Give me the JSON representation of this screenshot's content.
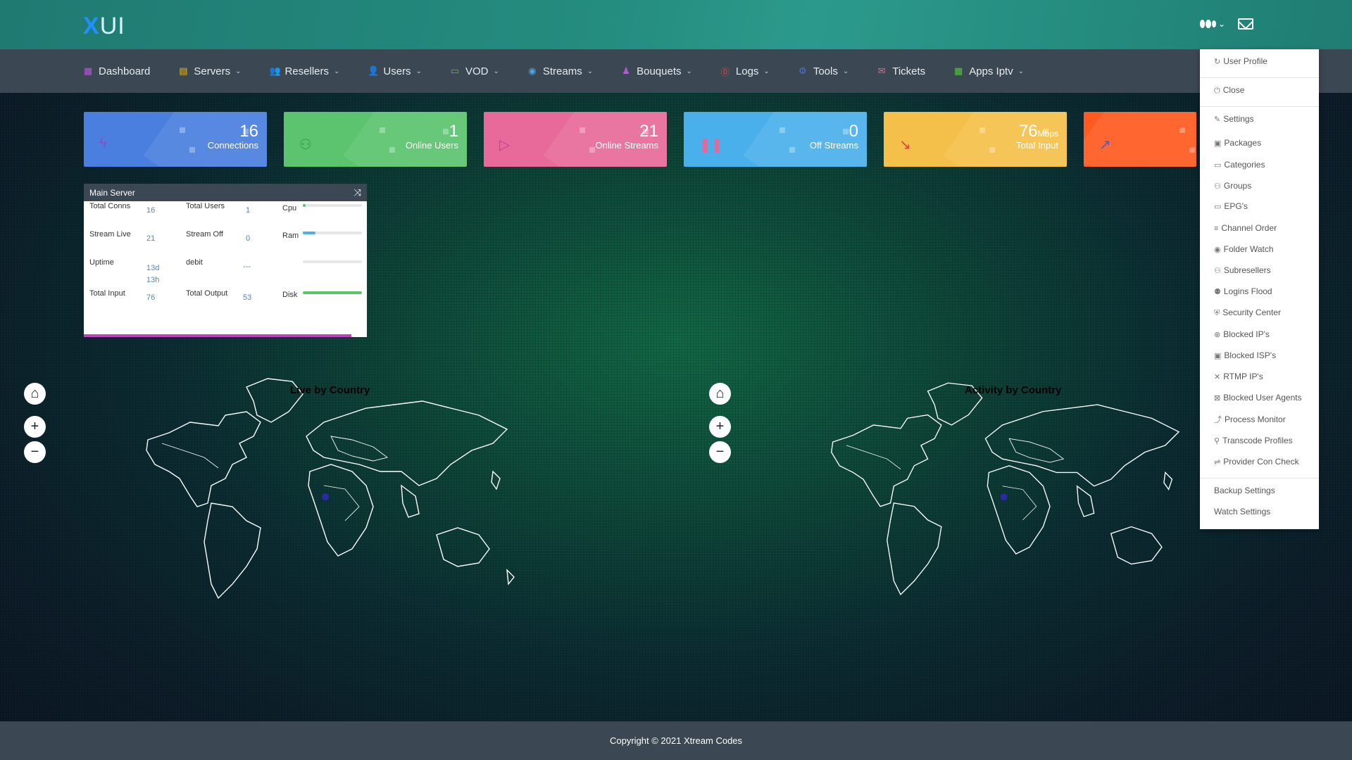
{
  "app": {
    "logo_x": "X",
    "logo_ui": "UI"
  },
  "nav": [
    {
      "label": "Dashboard",
      "icon": "grid-icon",
      "color": "#b05bd1",
      "glyph": "▦",
      "caret": false
    },
    {
      "label": "Servers",
      "icon": "server-icon",
      "color": "#e2b93b",
      "glyph": "▤",
      "caret": true
    },
    {
      "label": "Resellers",
      "icon": "resellers-icon",
      "color": "#4a7fe0",
      "glyph": "👥",
      "caret": true
    },
    {
      "label": "Users",
      "icon": "user-icon",
      "color": "#e06a8a",
      "glyph": "👤",
      "caret": true
    },
    {
      "label": "VOD",
      "icon": "video-icon",
      "color": "#5cbf4e",
      "glyph": "▭",
      "caret": true
    },
    {
      "label": "Streams",
      "icon": "play-icon",
      "color": "#4aa6e8",
      "glyph": "◉",
      "caret": true
    },
    {
      "label": "Bouquets",
      "icon": "bouquet-icon",
      "color": "#b05bd1",
      "glyph": "♟",
      "caret": true
    },
    {
      "label": "Logs",
      "icon": "alert-icon",
      "color": "#e04848",
      "glyph": "⓪",
      "caret": true
    },
    {
      "label": "Tools",
      "icon": "tools-icon",
      "color": "#4a6fe0",
      "glyph": "⚙",
      "caret": true
    },
    {
      "label": "Tickets",
      "icon": "mail-icon",
      "color": "#e06a8a",
      "glyph": "✉",
      "caret": false
    },
    {
      "label": "Apps Iptv",
      "icon": "apps-icon",
      "color": "#5cbf4e",
      "glyph": "▦",
      "caret": true
    }
  ],
  "cards": [
    {
      "value": "16",
      "unit": "",
      "label": "Connections",
      "color": "#4a7fdf",
      "icon": "bolt-icon",
      "glyph": "ϟ",
      "icon_color": "#8a4ec4"
    },
    {
      "value": "1",
      "unit": "",
      "label": "Online Users",
      "color": "#5cc46e",
      "icon": "users-icon",
      "glyph": "⚇",
      "icon_color": "#2f9c4a"
    },
    {
      "value": "21",
      "unit": "",
      "label": "Online Streams",
      "color": "#e86a9a",
      "icon": "play-icon",
      "glyph": "▷",
      "icon_color": "#c240a0"
    },
    {
      "value": "0",
      "unit": "",
      "label": "Off Streams",
      "color": "#4ab0ec",
      "icon": "pause-icon",
      "glyph": "❚❚",
      "icon_color": "#e06a9a"
    },
    {
      "value": "76",
      "unit": "Mbps",
      "label": "Total Input",
      "color": "#f5c04a",
      "icon": "trend-down-icon",
      "glyph": "↘",
      "icon_color": "#e04040"
    },
    {
      "value": "",
      "unit": "",
      "label": "",
      "color": "#ff5a1f",
      "icon": "trend-up-icon",
      "glyph": "↗",
      "icon_color": "#4a5fd0"
    }
  ],
  "server": {
    "title": "Main Server",
    "total_conns_label": "Total Conns",
    "total_conns": "16",
    "total_users_label": "Total Users",
    "total_users": "1",
    "stream_live_label": "Stream Live",
    "stream_live": "21",
    "stream_off_label": "Stream Off",
    "stream_off": "0",
    "uptime_label": "Uptime",
    "uptime": "13d 13h",
    "debit_label": "debit",
    "debit": "---",
    "total_input_label": "Total Input",
    "total_input": "76",
    "total_output_label": "Total Output",
    "total_output": "53",
    "cpu_label": "Cpu",
    "cpu_level": 0.05,
    "ram_label": "Ram",
    "ram_level": 0.22,
    "extra_level": 0,
    "disk_label": "Disk",
    "disk_level": 1.0
  },
  "maps": {
    "left_title": "Live by Country",
    "right_title": "Activity by Country",
    "home_glyph": "⌂",
    "plus_glyph": "+",
    "minus_glyph": "−"
  },
  "dropdown": [
    {
      "label": "User Profile",
      "glyph": "↻",
      "icon": "refresh-icon"
    },
    {
      "label": "Close",
      "glyph": "⏻",
      "icon": "power-icon"
    },
    {
      "label": "Settings",
      "glyph": "✎",
      "icon": "wrench-icon"
    },
    {
      "label": "Packages",
      "glyph": "▣",
      "icon": "package-icon"
    },
    {
      "label": "Categories",
      "glyph": "▭",
      "icon": "folder-icon"
    },
    {
      "label": "Groups",
      "glyph": "⚇",
      "icon": "groups-icon"
    },
    {
      "label": "EPG's",
      "glyph": "▭",
      "icon": "epg-icon"
    },
    {
      "label": "Channel Order",
      "glyph": "≡",
      "icon": "list-icon"
    },
    {
      "label": "Folder Watch",
      "glyph": "◉",
      "icon": "eye-icon"
    },
    {
      "label": "Subresellers",
      "glyph": "⚇",
      "icon": "subresellers-icon"
    },
    {
      "label": "Logins Flood",
      "glyph": "⚉",
      "icon": "user-lock-icon"
    },
    {
      "label": "Security Center",
      "glyph": "⛨",
      "icon": "shield-icon"
    },
    {
      "label": "Blocked IP's",
      "glyph": "⊗",
      "icon": "block-icon"
    },
    {
      "label": "Blocked ISP's",
      "glyph": "▣",
      "icon": "isp-icon"
    },
    {
      "label": "RTMP IP's",
      "glyph": "✕",
      "icon": "x-icon"
    },
    {
      "label": "Blocked User Agents",
      "glyph": "⊠",
      "icon": "agent-block-icon"
    },
    {
      "label": "Process Monitor",
      "glyph": "⤴",
      "icon": "chart-line-icon"
    },
    {
      "label": "Transcode Profiles",
      "glyph": "⚲",
      "icon": "search-icon"
    },
    {
      "label": "Provider Con Check",
      "glyph": "⇌",
      "icon": "exchange-icon"
    },
    {
      "label": "Backup Settings",
      "glyph": "",
      "icon": ""
    },
    {
      "label": "Watch Settings",
      "glyph": "",
      "icon": ""
    }
  ],
  "footer": {
    "text": "Copyright © 2021 Xtream Codes"
  }
}
